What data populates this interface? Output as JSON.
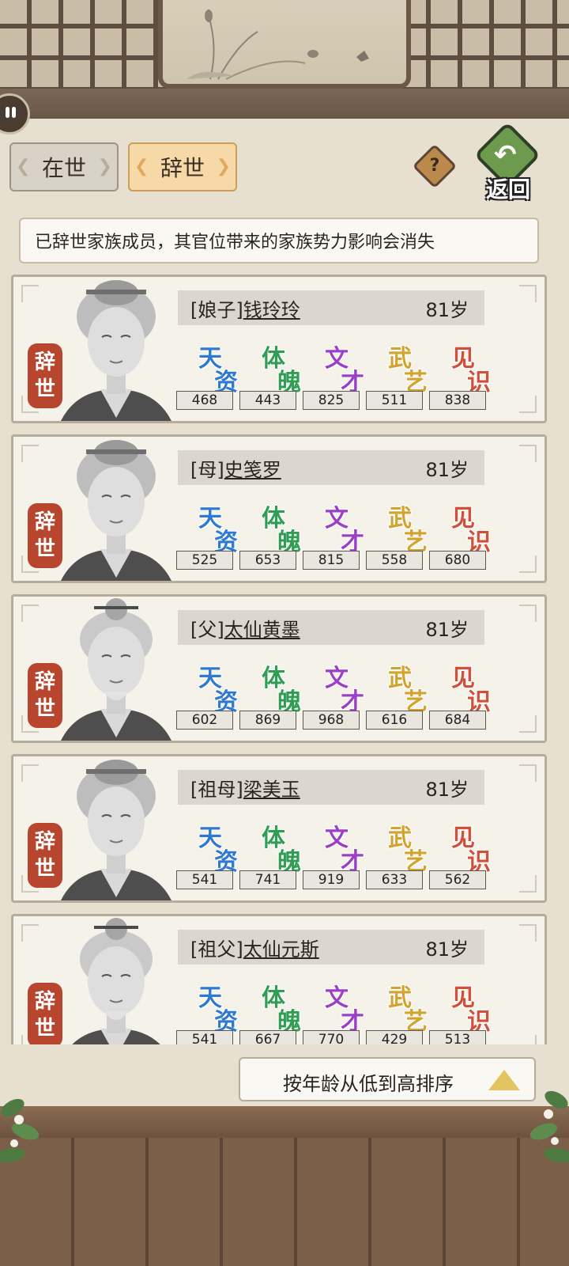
{
  "tabs": {
    "alive": "在世",
    "deceased": "辞世"
  },
  "help_label": "?",
  "back_label": "返回",
  "notice": "已辞世家族成员，其官位带来的家族势力影响会消失",
  "attribute_labels": [
    {
      "c1": "天",
      "c2": "资",
      "color": "#2f79d1"
    },
    {
      "c1": "体",
      "c2": "魄",
      "color": "#2f9e52"
    },
    {
      "c1": "文",
      "c2": "才",
      "color": "#9b3fc6"
    },
    {
      "c1": "武",
      "c2": "艺",
      "color": "#d2a32f"
    },
    {
      "c1": "见",
      "c2": "识",
      "color": "#d0503a"
    }
  ],
  "status_badge": {
    "line1": "辞",
    "line2": "世"
  },
  "members": [
    {
      "relation": "[娘子]",
      "name": "钱玲玲",
      "age": "81岁",
      "gender": "female",
      "stats": [
        "468",
        "443",
        "825",
        "511",
        "838"
      ]
    },
    {
      "relation": "[母]",
      "name": "史笺罗",
      "age": "81岁",
      "gender": "female",
      "stats": [
        "525",
        "653",
        "815",
        "558",
        "680"
      ]
    },
    {
      "relation": "[父]",
      "name": "太仙黄墨",
      "age": "81岁",
      "gender": "male",
      "stats": [
        "602",
        "869",
        "968",
        "616",
        "684"
      ]
    },
    {
      "relation": "[祖母]",
      "name": "梁美玉",
      "age": "81岁",
      "gender": "female",
      "stats": [
        "541",
        "741",
        "919",
        "633",
        "562"
      ]
    },
    {
      "relation": "[祖父]",
      "name": "太仙元斯",
      "age": "81岁",
      "gender": "male",
      "stats": [
        "541",
        "667",
        "770",
        "429",
        "513"
      ]
    }
  ],
  "sort_label": "按年龄从低到高排序"
}
